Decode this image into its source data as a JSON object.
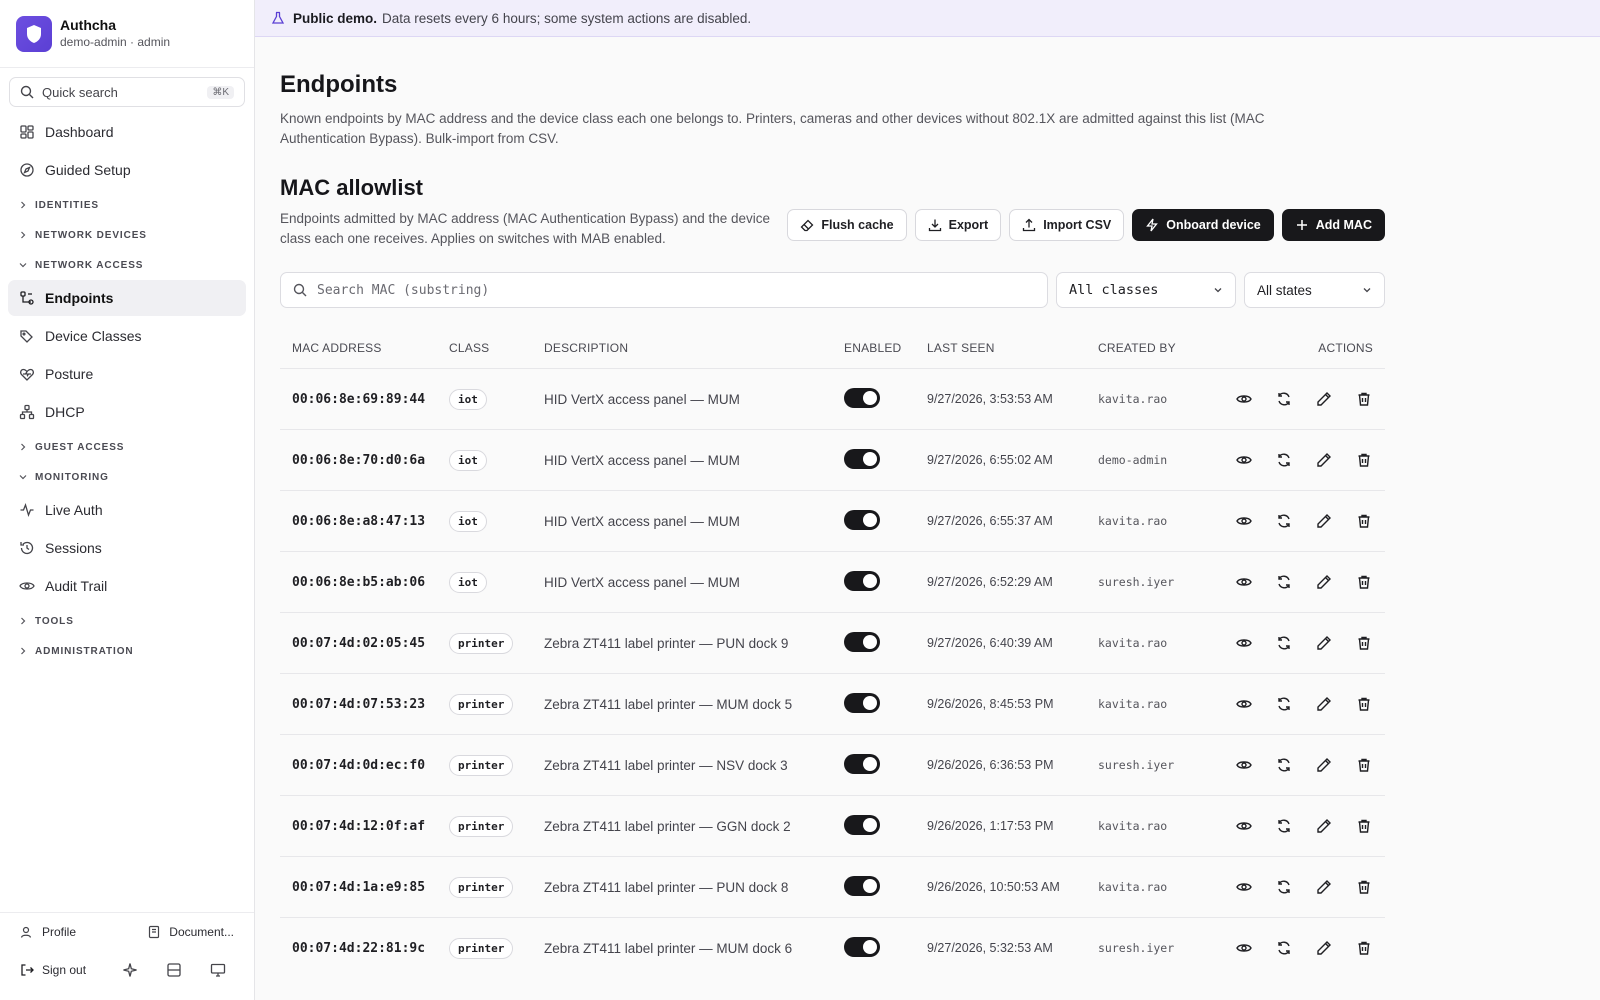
{
  "app": {
    "name": "Authcha",
    "user": "demo-admin · admin"
  },
  "sidebar": {
    "search_placeholder": "Quick search",
    "search_shortcut": "⌘K",
    "items": [
      {
        "label": "Dashboard",
        "icon": "dashboard-icon"
      },
      {
        "label": "Guided Setup",
        "icon": "compass-icon"
      }
    ],
    "groups": {
      "identities": "IDENTITIES",
      "network_devices": "NETWORK DEVICES",
      "network_access": "NETWORK ACCESS",
      "guest_access": "GUEST ACCESS",
      "monitoring": "MONITORING",
      "tools": "TOOLS",
      "administration": "ADMINISTRATION"
    },
    "network_access_items": [
      {
        "label": "Endpoints",
        "active": true
      },
      {
        "label": "Device Classes"
      },
      {
        "label": "Posture"
      },
      {
        "label": "DHCP"
      }
    ],
    "monitoring_items": [
      {
        "label": "Live Auth"
      },
      {
        "label": "Sessions"
      },
      {
        "label": "Audit Trail"
      }
    ],
    "footer": {
      "profile": "Profile",
      "docs": "Document...",
      "sign_out": "Sign out"
    }
  },
  "banner": {
    "bold": "Public demo.",
    "text": "Data resets every 6 hours; some system actions are disabled."
  },
  "page": {
    "title": "Endpoints",
    "description": "Known endpoints by MAC address and the device class each one belongs to. Printers, cameras and other devices without 802.1X are admitted against this list (MAC Authentication Bypass). Bulk-import from CSV."
  },
  "section": {
    "title": "MAC allowlist",
    "description": "Endpoints admitted by MAC address (MAC Authentication Bypass) and the device class each one receives. Applies on switches with MAB enabled.",
    "buttons": {
      "flush": "Flush cache",
      "export": "Export",
      "import": "Import CSV",
      "onboard": "Onboard device",
      "add": "Add MAC"
    }
  },
  "filters": {
    "search_placeholder": "Search MAC (substring)",
    "class_select": "All classes",
    "state_select": "All states"
  },
  "table": {
    "headers": {
      "mac": "MAC ADDRESS",
      "class": "CLASS",
      "description": "DESCRIPTION",
      "enabled": "ENABLED",
      "last_seen": "LAST SEEN",
      "created_by": "CREATED BY",
      "actions": "ACTIONS"
    },
    "rows": [
      {
        "mac": "00:06:8e:69:89:44",
        "class": "iot",
        "description": "HID VertX access panel — MUM",
        "enabled": true,
        "last_seen": "9/27/2026, 3:53:53 AM",
        "created_by": "kavita.rao"
      },
      {
        "mac": "00:06:8e:70:d0:6a",
        "class": "iot",
        "description": "HID VertX access panel — MUM",
        "enabled": true,
        "last_seen": "9/27/2026, 6:55:02 AM",
        "created_by": "demo-admin"
      },
      {
        "mac": "00:06:8e:a8:47:13",
        "class": "iot",
        "description": "HID VertX access panel — MUM",
        "enabled": true,
        "last_seen": "9/27/2026, 6:55:37 AM",
        "created_by": "kavita.rao"
      },
      {
        "mac": "00:06:8e:b5:ab:06",
        "class": "iot",
        "description": "HID VertX access panel — MUM",
        "enabled": true,
        "last_seen": "9/27/2026, 6:52:29 AM",
        "created_by": "suresh.iyer"
      },
      {
        "mac": "00:07:4d:02:05:45",
        "class": "printer",
        "description": "Zebra ZT411 label printer — PUN dock 9",
        "enabled": true,
        "last_seen": "9/27/2026, 6:40:39 AM",
        "created_by": "kavita.rao"
      },
      {
        "mac": "00:07:4d:07:53:23",
        "class": "printer",
        "description": "Zebra ZT411 label printer — MUM dock 5",
        "enabled": true,
        "last_seen": "9/26/2026, 8:45:53 PM",
        "created_by": "kavita.rao"
      },
      {
        "mac": "00:07:4d:0d:ec:f0",
        "class": "printer",
        "description": "Zebra ZT411 label printer — NSV dock 3",
        "enabled": true,
        "last_seen": "9/26/2026, 6:36:53 PM",
        "created_by": "suresh.iyer"
      },
      {
        "mac": "00:07:4d:12:0f:af",
        "class": "printer",
        "description": "Zebra ZT411 label printer — GGN dock 2",
        "enabled": true,
        "last_seen": "9/26/2026, 1:17:53 PM",
        "created_by": "kavita.rao"
      },
      {
        "mac": "00:07:4d:1a:e9:85",
        "class": "printer",
        "description": "Zebra ZT411 label printer — PUN dock 8",
        "enabled": true,
        "last_seen": "9/26/2026, 10:50:53 AM",
        "created_by": "kavita.rao"
      },
      {
        "mac": "00:07:4d:22:81:9c",
        "class": "printer",
        "description": "Zebra ZT411 label printer — MUM dock 6",
        "enabled": true,
        "last_seen": "9/27/2026, 5:32:53 AM",
        "created_by": "suresh.iyer"
      }
    ]
  },
  "colors": {
    "accent": "#5b3fd4",
    "banner_bg": "#f1eefb",
    "dark_button": "#18181b"
  }
}
